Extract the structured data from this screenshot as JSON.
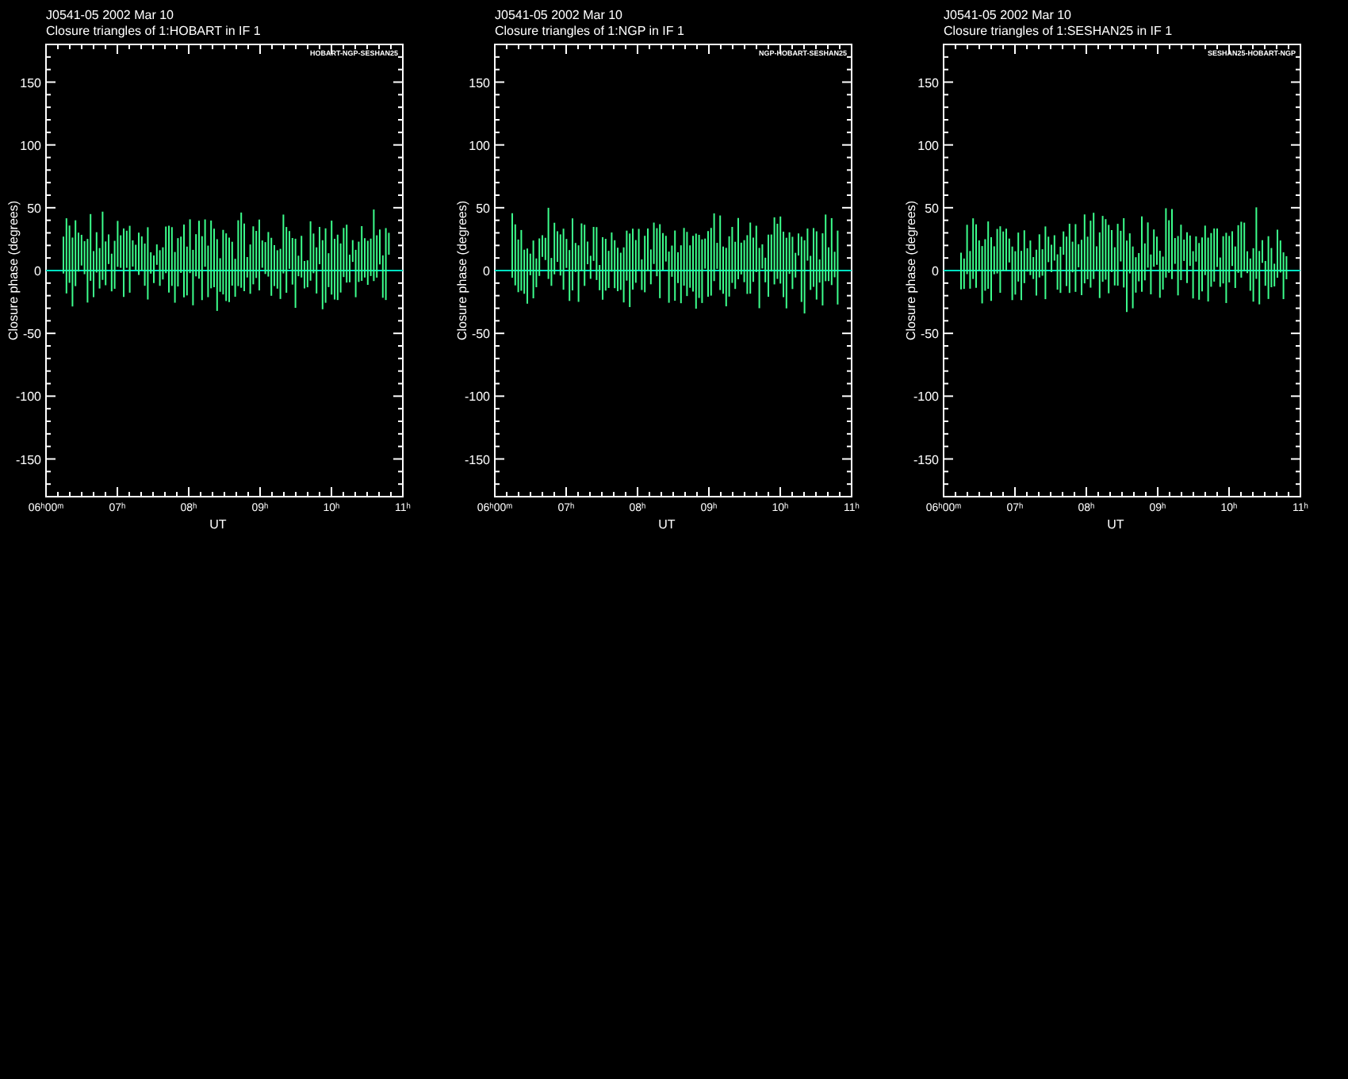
{
  "panels": [
    {
      "source": "J0541-05  2002 Mar 10",
      "subtitle": "Closure triangles of 1:HOBART in IF 1",
      "triangle": "HOBART-NGP-SESHAN25",
      "ylabel": "Closure phase  (degrees)",
      "xlabel": "UT",
      "yticks": [
        "150",
        "100",
        "50",
        "0",
        "-50",
        "-100",
        "-150"
      ],
      "xticks": [
        "06ʰ00ᵐ",
        "07ʰ",
        "08ʰ",
        "09ʰ",
        "10ʰ",
        "11ʰ"
      ]
    },
    {
      "source": "J0541-05  2002 Mar 10",
      "subtitle": "Closure triangles of 1:NGP in IF 1",
      "triangle": "NGP-HOBART-SESHAN25",
      "ylabel": "Closure phase  (degrees)",
      "xlabel": "UT",
      "yticks": [
        "150",
        "100",
        "50",
        "0",
        "-50",
        "-100",
        "-150"
      ],
      "xticks": [
        "06ʰ00ᵐ",
        "07ʰ",
        "08ʰ",
        "09ʰ",
        "10ʰ",
        "11ʰ"
      ]
    },
    {
      "source": "J0541-05  2002 Mar 10",
      "subtitle": "Closure triangles of 1:SESHAN25 in IF 1",
      "triangle": "SESHAN25-HOBART-NGP",
      "ylabel": "Closure phase  (degrees)",
      "xlabel": "UT",
      "yticks": [
        "150",
        "100",
        "50",
        "0",
        "-50",
        "-100",
        "-150"
      ],
      "xticks": [
        "06ʰ00ᵐ",
        "07ʰ",
        "08ʰ",
        "09ʰ",
        "10ʰ",
        "11ʰ"
      ]
    }
  ]
}
